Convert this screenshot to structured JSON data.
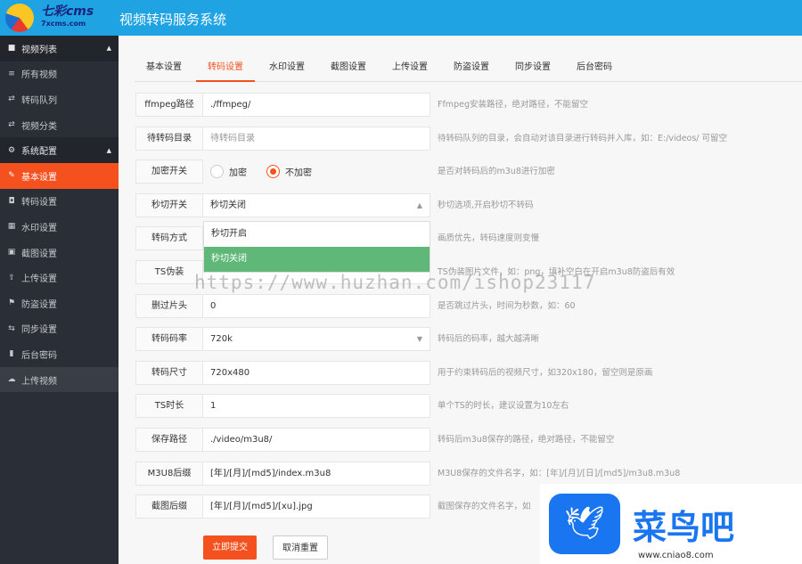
{
  "header": {
    "logo_text": "七彩cms",
    "logo_sub": "7xcms.com",
    "title": "视频转码服务系统"
  },
  "sidebar": {
    "items": [
      {
        "label": "视频列表",
        "icon": "video-icon",
        "type": "group"
      },
      {
        "label": "所有视频",
        "icon": "list-icon"
      },
      {
        "label": "转码队列",
        "icon": "exchange-icon"
      },
      {
        "label": "视频分类",
        "icon": "exchange-icon"
      },
      {
        "label": "系统配置",
        "icon": "gear-icon",
        "type": "group"
      },
      {
        "label": "基本设置",
        "icon": "edit-icon",
        "active": true
      },
      {
        "label": "转码设置",
        "icon": "camera-icon"
      },
      {
        "label": "水印设置",
        "icon": "watermark-icon"
      },
      {
        "label": "截图设置",
        "icon": "image-icon"
      },
      {
        "label": "上传设置",
        "icon": "upload-icon"
      },
      {
        "label": "防盗设置",
        "icon": "flag-icon"
      },
      {
        "label": "同步设置",
        "icon": "sync-icon"
      },
      {
        "label": "后台密码",
        "icon": "lock-icon"
      },
      {
        "label": "上传视频",
        "icon": "cloud-upload-icon"
      }
    ]
  },
  "tabs": [
    "基本设置",
    "转码设置",
    "水印设置",
    "截图设置",
    "上传设置",
    "防盗设置",
    "同步设置",
    "后台密码"
  ],
  "active_tab": 1,
  "form": {
    "rows": [
      {
        "label": "ffmpeg路径",
        "value": "./ffmpeg/",
        "hint": "Ffmpeg安装路径，绝对路径，不能留空"
      },
      {
        "label": "待转码目录",
        "placeholder": "待转码目录",
        "hint": "待转码队列的目录，会自动对该目录进行转码并入库，如：E:/videos/ 可留空"
      },
      {
        "label": "加密开关",
        "options": [
          "加密",
          "不加密"
        ],
        "selected": "不加密",
        "hint": "是否对转码后的m3u8进行加密"
      },
      {
        "label": "秒切开关",
        "value": "秒切关闭",
        "hint": "秒切选项,开启秒切不转码"
      },
      {
        "label": "转码方式",
        "value": "",
        "hint": "画质优先，转码速度则变慢"
      },
      {
        "label": "TS伪装",
        "value": "",
        "hint": "TS伪装图片文件，如：png，填补空白在开启m3u8防盗后有效"
      },
      {
        "label": "删过片头",
        "value": "0",
        "hint": "是否跳过片头，时间为秒数，如：60"
      },
      {
        "label": "转码码率",
        "value": "720k",
        "hint": "转码后的码率，越大越清晰"
      },
      {
        "label": "转码尺寸",
        "value": "720x480",
        "hint": "用于约束转码后的视频尺寸，如320x180，留空则是原画"
      },
      {
        "label": "TS时长",
        "value": "1",
        "hint": "单个TS的时长，建议设置为10左右"
      },
      {
        "label": "保存路径",
        "value": "./video/m3u8/",
        "hint": "转码后m3u8保存的路径，绝对路径，不能留空"
      },
      {
        "label": "M3U8后缀",
        "value": "[年]/[月]/[md5]/index.m3u8",
        "hint": "M3U8保存的文件名字，如：[年]/[月]/[日]/[md5]/m3u8.m3u8"
      },
      {
        "label": "截图后缀",
        "value": "[年]/[月]/[md5]/[xu].jpg",
        "hint": "截图保存的文件名字，如"
      }
    ]
  },
  "dropdown": {
    "options": [
      "秒切开启",
      "秒切关闭"
    ],
    "selected": "秒切关闭"
  },
  "buttons": {
    "submit": "立即提交",
    "reset": "取消重置"
  },
  "watermark": "https://www.huzhan.com/ishop23117",
  "badge": {
    "name": "菜鸟吧",
    "url": "www.cniao8.com"
  }
}
